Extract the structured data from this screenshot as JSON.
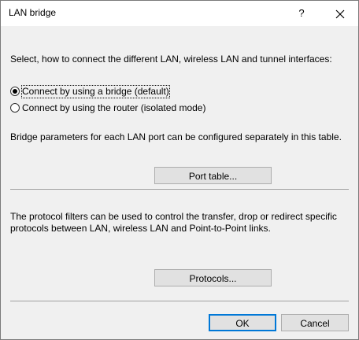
{
  "window": {
    "title": "LAN bridge",
    "help_label": "?",
    "close_label": "✕"
  },
  "intro_text": "Select, how to connect the different LAN, wireless LAN and tunnel interfaces:",
  "radio_options": [
    {
      "label": "Connect by using a bridge (default)",
      "checked": true
    },
    {
      "label": "Connect by using the router (isolated mode)",
      "checked": false
    }
  ],
  "bridge_text": "Bridge parameters for each LAN port can be configured separately in this table.",
  "port_table_button": "Port table...",
  "protocol_text": "The protocol filters can be used to control the transfer, drop or redirect specific protocols between LAN, wireless LAN and Point-to-Point links.",
  "protocols_button": "Protocols...",
  "ok_button": "OK",
  "cancel_button": "Cancel"
}
